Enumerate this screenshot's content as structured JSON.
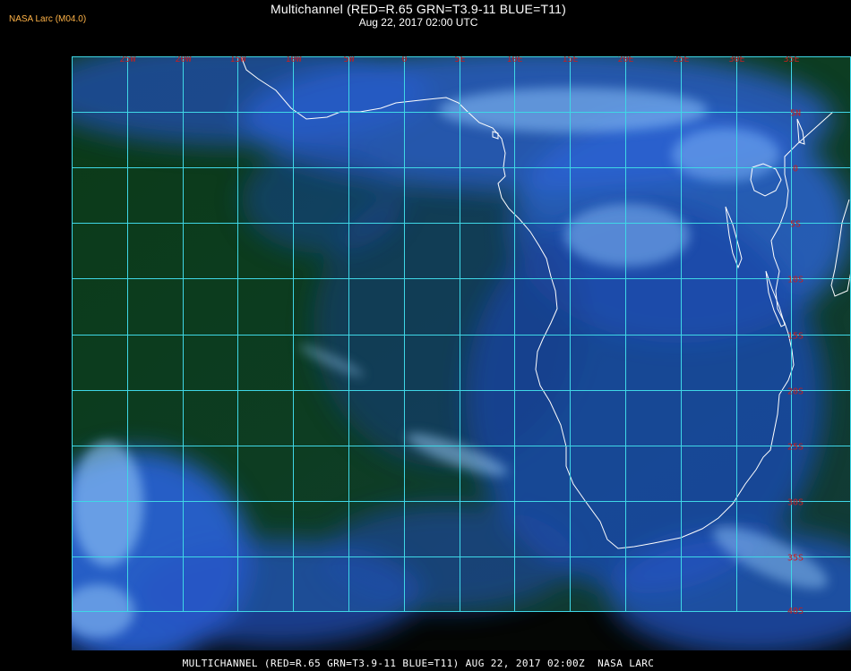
{
  "header": {
    "brand": "NASA Larc (M04.0)",
    "title": "Multichannel (RED=R.65 GRN=T3.9-11 BLUE=T11)",
    "subtitle": "Aug 22, 2017 02:00 UTC"
  },
  "footer": {
    "caption": "MULTICHANNEL (RED=R.65 GRN=T3.9-11 BLUE=T11) AUG 22, 2017 02:00Z  NASA LARC"
  },
  "map": {
    "longitude_labels": [
      "25W",
      "20W",
      "15W",
      "10W",
      "5W",
      "0",
      "5E",
      "10E",
      "15E",
      "20E",
      "25E",
      "30E",
      "35E"
    ],
    "latitude_labels": [
      "5N",
      "0",
      "5S",
      "10S",
      "15S",
      "20S",
      "25S",
      "30S",
      "35S",
      "40S"
    ],
    "colors": {
      "grid": "#3fd7e6",
      "grid_label": "#c81e1e",
      "coastline": "#ffffff",
      "ocean_clear": "#0a3a17",
      "land": "#143a8c",
      "cloud": "#3f7be0",
      "high_cloud": "#9fd4ff"
    }
  }
}
